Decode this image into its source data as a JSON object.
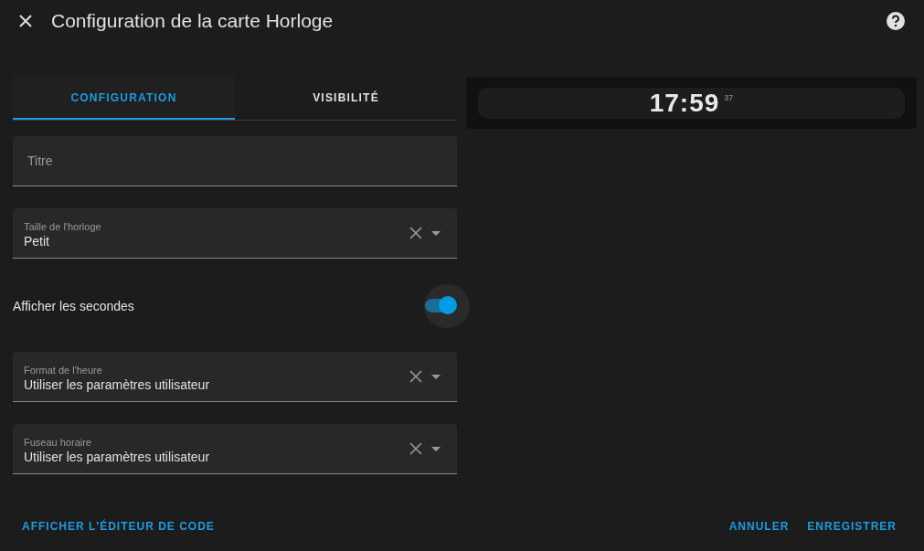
{
  "dialog": {
    "title": "Configuration de la carte Horloge"
  },
  "tabs": [
    {
      "label": "CONFIGURATION",
      "selected": true
    },
    {
      "label": "VISIBILITÉ",
      "selected": false
    }
  ],
  "fields": [
    {
      "kind": "text",
      "placeholder": "Titre"
    },
    {
      "kind": "select",
      "label": "Taille de l'horloge",
      "value": "Petit"
    },
    {
      "kind": "toggle",
      "label": "Afficher les secondes",
      "on": true
    },
    {
      "kind": "select",
      "label": "Format de l'heure",
      "value": "Utiliser les paramètres utilisateur"
    },
    {
      "kind": "select",
      "label": "Fuseau horaire",
      "value": "Utiliser les paramètres utilisateur"
    }
  ],
  "preview": {
    "time": "17:59",
    "seconds": "37"
  },
  "footer": {
    "left_button": "AFFICHER L'ÉDITEUR DE CODE",
    "buttons": [
      "ANNULER",
      "ENREGISTRER"
    ]
  }
}
